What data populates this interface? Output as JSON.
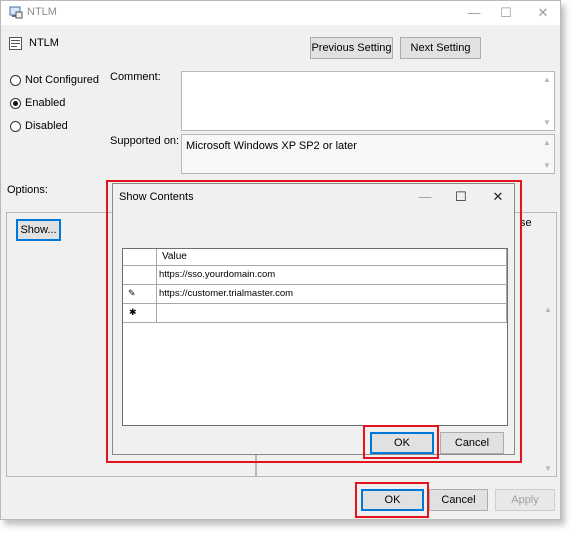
{
  "window": {
    "title": "NTLM",
    "policy_name": "NTLM",
    "previous_setting": "Previous Setting",
    "next_setting": "Next Setting",
    "minimize": "—",
    "maximize": "☐",
    "close": "✕"
  },
  "radios": {
    "not_configured": "Not Configured",
    "enabled": "Enabled",
    "disabled": "Disabled",
    "selected": "Enabled"
  },
  "fields": {
    "comment_label": "Comment:",
    "supported_label": "Supported on:",
    "supported_value": "Microsoft Windows XP SP2 or later"
  },
  "options": {
    "label": "Options:",
    "show_button": "Show...",
    "partial_text": "se"
  },
  "dialog": {
    "title": "Show Contents",
    "minimize": "—",
    "maximize": "☐",
    "close": "✕",
    "column_header": "Value",
    "rows": [
      {
        "marker": "",
        "value": "https://sso.yourdomain.com"
      },
      {
        "marker": "✎",
        "value": "https://customer.trialmaster.com"
      },
      {
        "marker": "✱",
        "value": ""
      }
    ],
    "ok": "OK",
    "cancel": "Cancel"
  },
  "footer": {
    "ok": "OK",
    "cancel": "Cancel",
    "apply": "Apply"
  },
  "colors": {
    "highlight": "#e2141e",
    "focus": "#0078d7"
  }
}
